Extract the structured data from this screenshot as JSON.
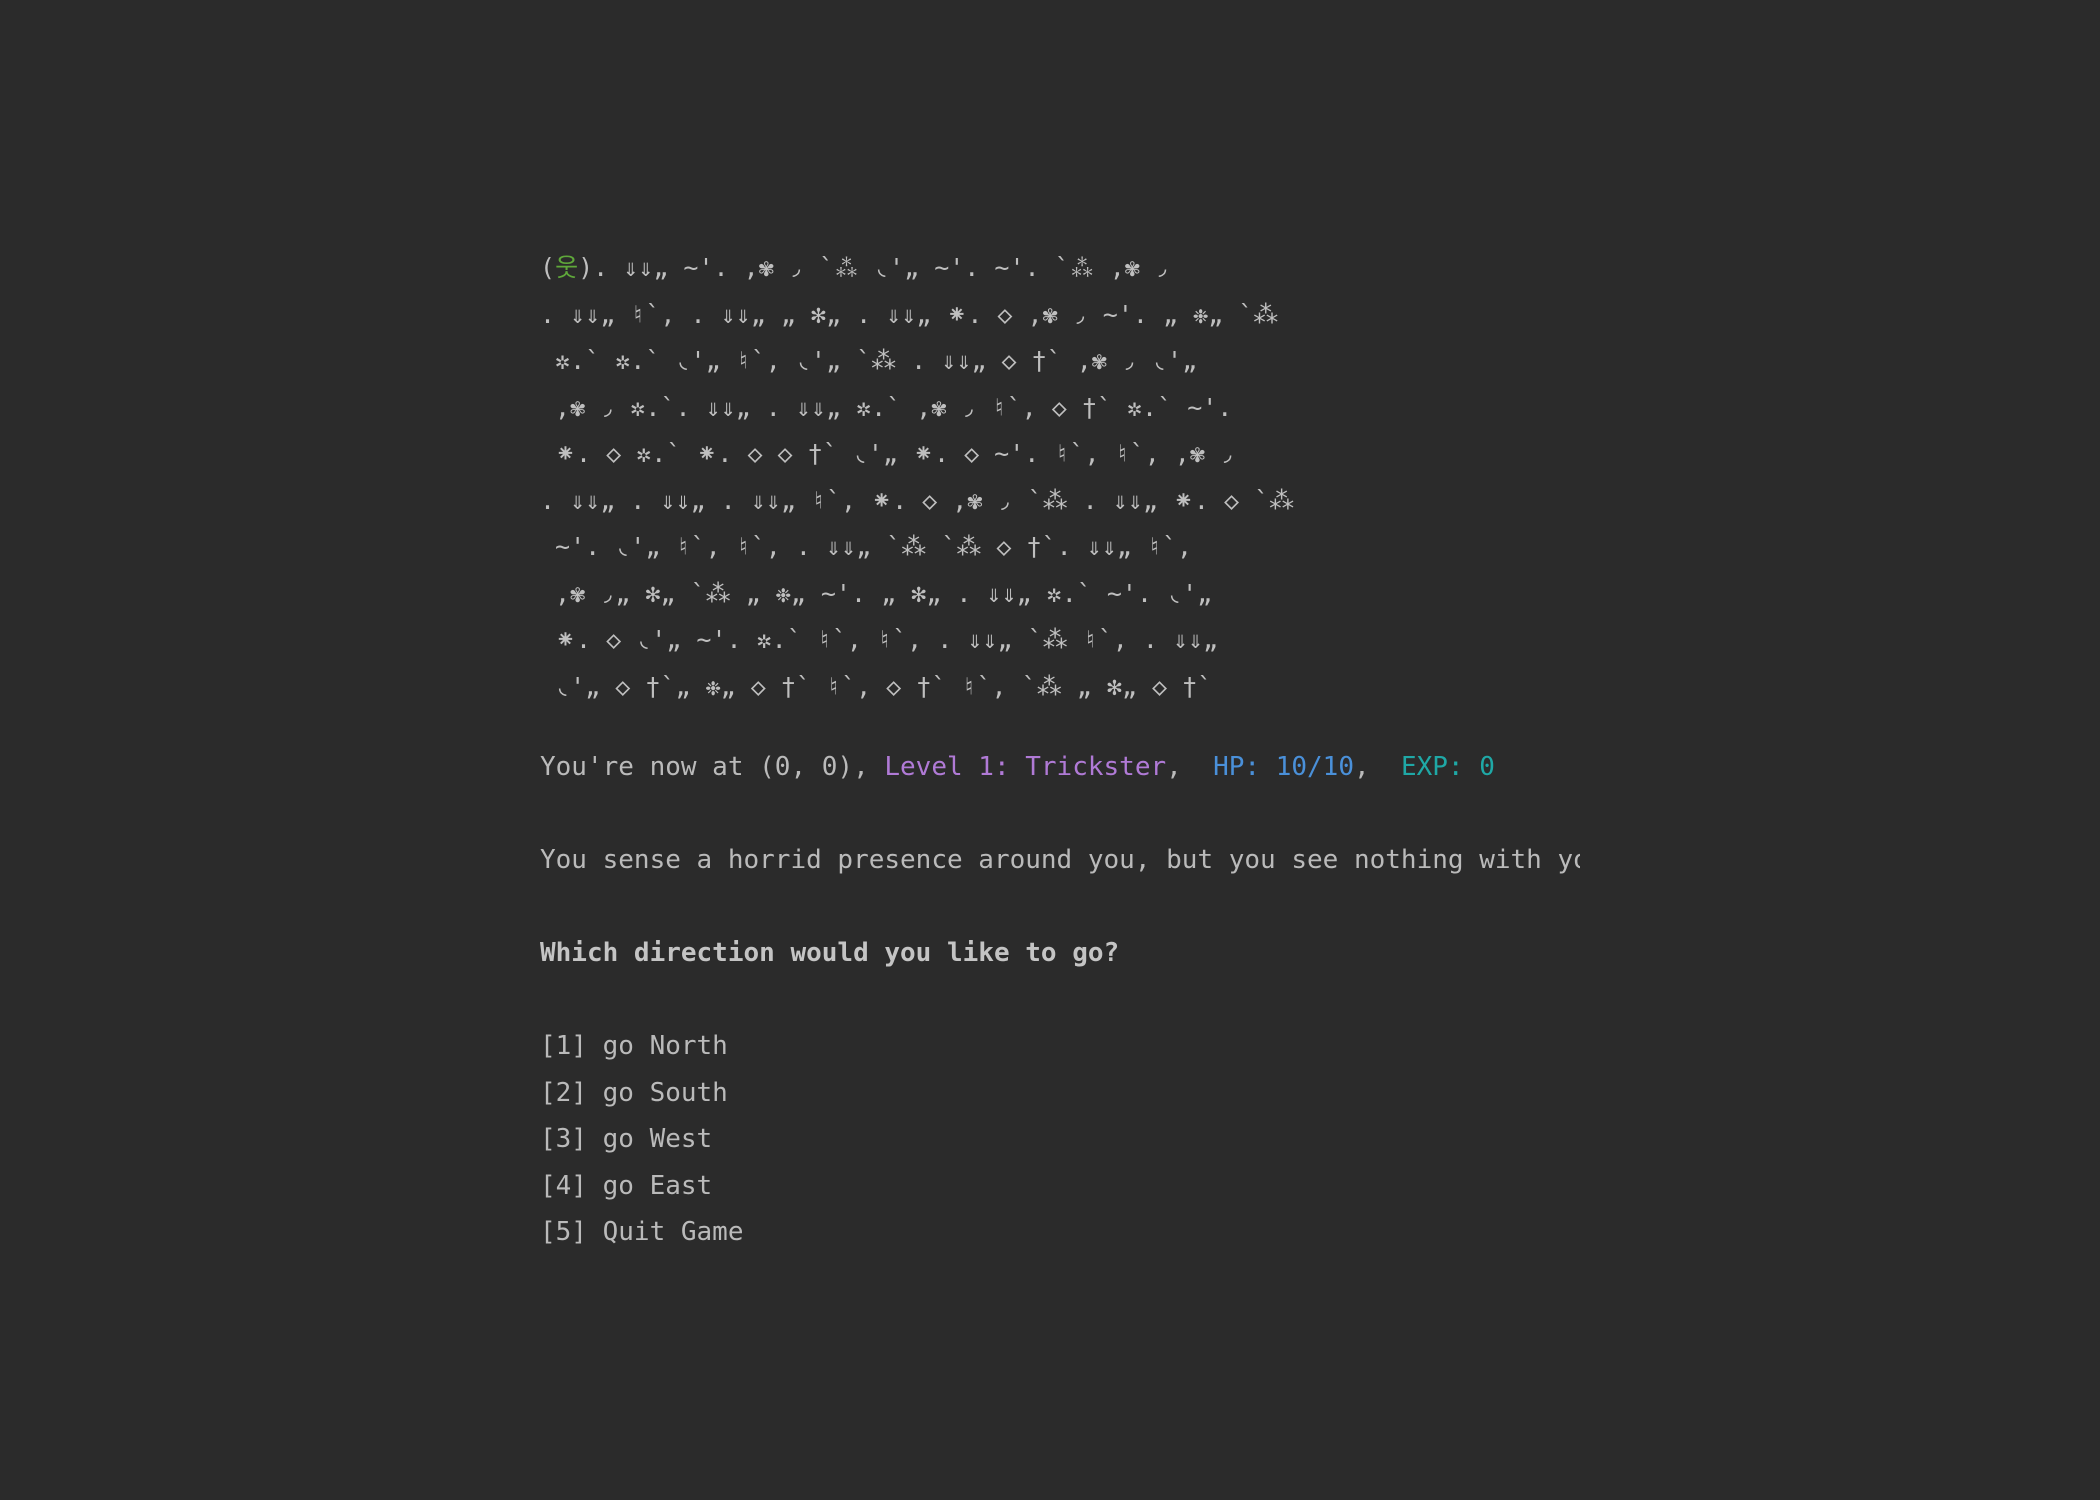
{
  "map": {
    "player_symbol": "웃",
    "first_line_prefix": "(",
    "first_line_suffix": "). ⇓⇓„ ~'. ,✾ ◞ `⁂ ◟'„ ~'. ~'. `⁂ ,✾ ◞",
    "lines": [
      ". ⇓⇓„ ♮`, . ⇓⇓„ „ ✻„ . ⇓⇓„ ⁕. ◇ ,✾ ◞ ~'. „ ❉„ `⁂",
      " ✲.` ✲.` ◟'„ ♮`, ◟'„ `⁂ . ⇓⇓„ ◇ †` ,✾ ◞ ◟'„",
      " ,✾ ◞ ✲.`. ⇓⇓„ . ⇓⇓„ ✲.` ,✾ ◞ ♮`, ◇ †` ✲.` ~'.",
      " ⁕. ◇ ✲.` ⁕. ◇ ◇ †` ◟'„ ⁕. ◇ ~'. ♮`, ♮`, ,✾ ◞",
      ". ⇓⇓„ . ⇓⇓„ . ⇓⇓„ ♮`, ⁕. ◇ ,✾ ◞ `⁂ . ⇓⇓„ ⁕. ◇ `⁂",
      " ~'. ◟'„ ♮`, ♮`, . ⇓⇓„ `⁂ `⁂ ◇ †`. ⇓⇓„ ♮`,",
      " ,✾ ◞„ ✻„ `⁂ „ ❉„ ~'. „ ✻„ . ⇓⇓„ ✲.` ~'. ◟'„",
      " ⁕. ◇ ◟'„ ~'. ✲.` ♮`, ♮`, . ⇓⇓„ `⁂ ♮`, . ⇓⇓„",
      " ◟'„ ◇ †`„ ❉„ ◇ †` ♮`, ◇ †` ♮`, `⁂ „ ✻„ ◇ †`"
    ]
  },
  "status": {
    "location": "You're now at (0, 0), ",
    "level": "Level 1: Trickster",
    "sep1": ",  ",
    "hp": "HP: 10/10",
    "sep2": ",  ",
    "exp": "EXP: 0"
  },
  "message": "You sense a horrid presence around you, but you see nothing with you",
  "prompt": "Which direction would you like to go?",
  "options": [
    "[1] go North",
    "[2] go South",
    "[3] go West",
    "[4] go East",
    "[5] Quit Game"
  ],
  "colors": {
    "background": "#2b2b2b",
    "text": "#bababa",
    "player": "#5fa83a",
    "level": "#b07ad6",
    "hp": "#4a90d9",
    "exp": "#1fa8a6"
  }
}
